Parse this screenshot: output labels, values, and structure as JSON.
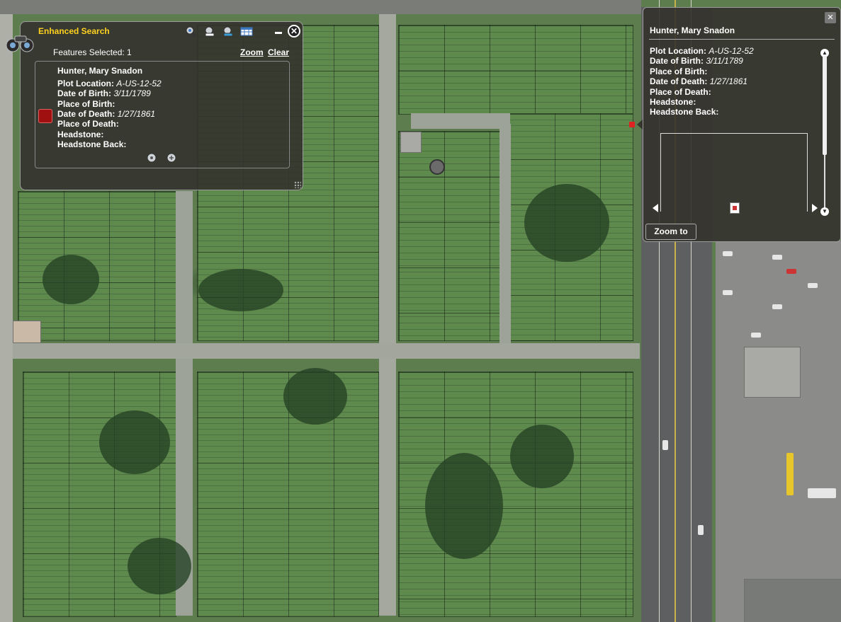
{
  "search_panel": {
    "title": "Enhanced Search",
    "toolbar_icons": [
      "search-by-name-icon",
      "search-by-plot-icon",
      "search-by-date-icon",
      "results-table-icon"
    ],
    "features_selected": "Features Selected: 1",
    "zoom_label": "Zoom",
    "clear_label": "Clear",
    "result": {
      "name": "Hunter, Mary Snadon",
      "plot_location_label": "Plot Location:",
      "plot_location": "A-US-12-52",
      "date_of_birth_label": "Date of Birth:",
      "date_of_birth": "3/11/1789",
      "place_of_birth_label": "Place of Birth:",
      "date_of_death_label": "Date of Death:",
      "date_of_death": "1/27/1861",
      "place_of_death_label": "Place of Death:",
      "headstone_label": "Headstone:",
      "headstone_back_label": "Headstone Back:",
      "swatch_color": "#a01010"
    }
  },
  "popup": {
    "title": "Hunter, Mary Snadon",
    "plot_location_label": "Plot Location:",
    "plot_location": "A-US-12-52",
    "date_of_birth_label": "Date of Birth:",
    "date_of_birth": "3/11/1789",
    "place_of_birth_label": "Place of Birth:",
    "date_of_death_label": "Date of Death:",
    "date_of_death": "1/27/1861",
    "place_of_death_label": "Place of Death:",
    "headstone_label": "Headstone:",
    "headstone_back_label": "Headstone Back:",
    "zoom_to_label": "Zoom to",
    "close_glyph": "✕"
  },
  "colors": {
    "accent_title": "#ffd21f",
    "panel_bg": "#34322c",
    "selection_marker": "#dd2222"
  }
}
